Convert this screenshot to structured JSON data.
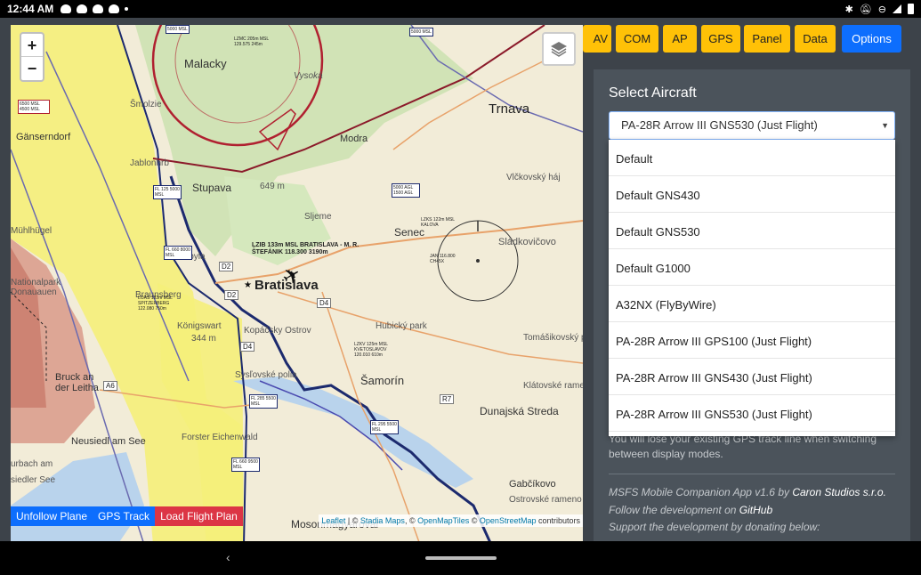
{
  "status": {
    "time": "12:44 AM"
  },
  "map": {
    "zoom_in": "+",
    "zoom_out": "−",
    "cities": [
      "Malacky",
      "Trnava",
      "Gänserndorf",
      "Stupava",
      "Modra",
      "Senec",
      "Bratislava",
      "Šamorín",
      "Dunajská Streda",
      "Gabčíkovo",
      "Mosonmagyaróvár",
      "Bruck an der Leitha",
      "Neusiedl am See"
    ],
    "places": [
      "Vysoká",
      "Šmolzie",
      "Jablonhrb",
      "649 m",
      "Nationalpark Donauauen",
      "Kobyla",
      "Braunsberg",
      "Königswart",
      "344 m",
      "Kopáčsky Ostrov",
      "Hubický park",
      "Tomášikovský park",
      "Klátovské rameno",
      "Vlčkovský háj",
      "Sládkovičovo",
      "Ostrovské rameno",
      "Sysľovské polia",
      "Sljeme",
      "urbach am",
      "siedler See",
      "Mühlhügel",
      "Forster Eichenwald"
    ],
    "roads": [
      "D2",
      "D2",
      "D4",
      "D4",
      "A6",
      "R7"
    ],
    "airspace_labels": [
      "5000 MSL",
      "LZMC 205m MSL 129.575 245m",
      "6500 MSL 4500 MSL",
      "FL 660 8000 MSL",
      "FL 125 5000 MSL",
      "5000 AGL 1500 AGL",
      "LZIB 133m MSL BRATISLAVA - M. R. ŠTEFÁNIK 118.300 3190m",
      "LZKS 122m MSL KALOVA",
      "JAN 116.800 CH45X",
      "LOAS 183m MSL SPITZERBERG 122.080 750m",
      "LZKV 125m MSL KVETOSLAVOV 120.010 610m",
      "FL 285 5500 MSL",
      "FL 295 5500 MSL",
      "FL 660 9500 MSL",
      "5000 MSL"
    ],
    "buttons": {
      "unfollow": "Unfollow Plane",
      "gps_track": "GPS Track",
      "load_plan": "Load Flight Plan"
    },
    "attribution": {
      "leaflet": "Leaflet",
      "sep1": " | © ",
      "stadia": "Stadia Maps",
      "sep2": ", © ",
      "omt": "OpenMapTiles",
      "sep3": " © ",
      "osm": "OpenStreetMap",
      "tail": " contributors"
    }
  },
  "nav": {
    "tabs": [
      {
        "label": "AV",
        "active": false
      },
      {
        "label": "COM",
        "active": false
      },
      {
        "label": "AP",
        "active": false
      },
      {
        "label": "GPS",
        "active": false
      },
      {
        "label": "Panel",
        "active": false
      },
      {
        "label": "Data",
        "active": false
      },
      {
        "label": "Options",
        "active": true
      }
    ]
  },
  "options": {
    "title": "Select Aircraft",
    "selected": "PA-28R Arrow III GNS530 (Just Flight)",
    "list": [
      "Default",
      "Default GNS430",
      "Default GNS530",
      "Default G1000",
      "A32NX (FlyByWire)",
      "PA-28R Arrow III GPS100 (Just Flight)",
      "PA-28R Arrow III GNS430 (Just Flight)",
      "PA-28R Arrow III GNS530 (Just Flight)"
    ],
    "note_line1": "You will lose your existing GPS track line when switching",
    "note_line2": "between display modes.",
    "footer_app": "MSFS Mobile Companion App v1.6 by ",
    "footer_company": "Caron Studios s.r.o.",
    "footer_follow": "Follow the development on ",
    "footer_github": "GitHub",
    "footer_support": "Support the development by donating below:"
  },
  "colors": {
    "accent": "#0d6efd",
    "tab": "#ffc107",
    "danger": "#dc3545",
    "panel": "#4b535b",
    "bg": "#3d434a"
  }
}
